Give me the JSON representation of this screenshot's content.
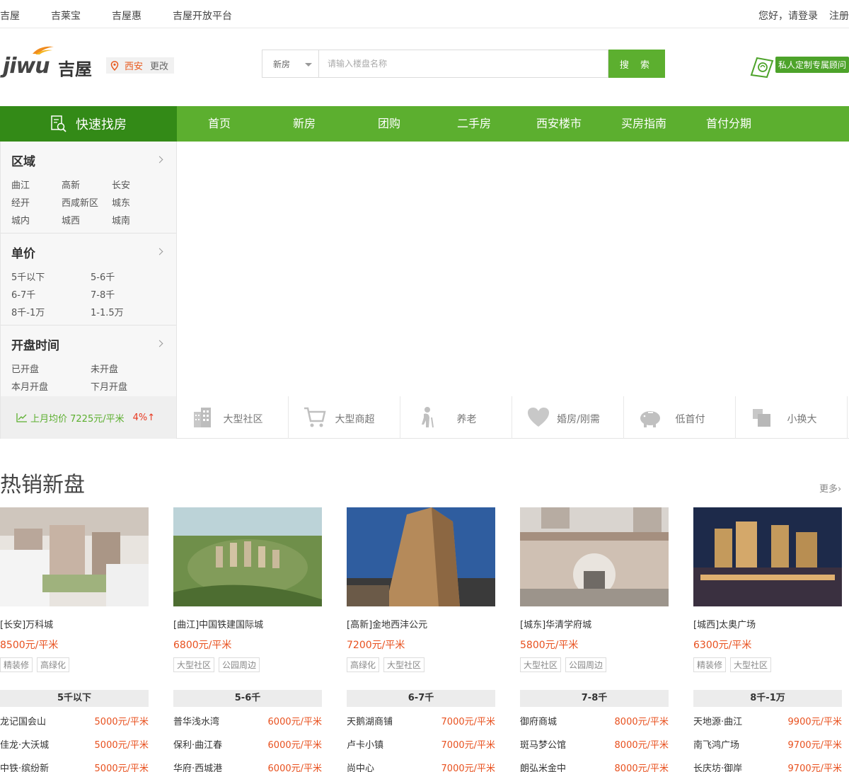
{
  "topbar": {
    "links": [
      "吉屋",
      "吉莱宝",
      "吉屋惠",
      "吉屋开放平台"
    ],
    "greeting": "您好，请登录",
    "register": "注册"
  },
  "header": {
    "logo_text": "jiwu",
    "logo_cn": "吉屋",
    "city": "西安",
    "change_city": "更改",
    "search_type": "新房",
    "search_placeholder": "请输入楼盘名称",
    "search_button": "搜 索",
    "advisor_label": "私人定制专属顾问"
  },
  "nav": {
    "quick": "快速找房",
    "items": [
      "首页",
      "新房",
      "团购",
      "二手房",
      "西安楼市",
      "买房指南",
      "首付分期"
    ]
  },
  "sidebar": {
    "region": {
      "title": "区域",
      "options": [
        "曲江",
        "高新",
        "长安",
        "经开",
        "西咸新区",
        "城东",
        "城内",
        "城西",
        "城南"
      ]
    },
    "price": {
      "title": "单价",
      "options": [
        "5千以下",
        "5-6千",
        "6-7千",
        "7-8千",
        "8千-1万",
        "1-1.5万"
      ]
    },
    "opening": {
      "title": "开盘时间",
      "options": [
        "已开盘",
        "未开盘",
        "本月开盘",
        "下月开盘"
      ]
    },
    "avg_price": "上月均价 7225元/平米",
    "avg_change": "4%↑"
  },
  "features": [
    {
      "label": "大型社区",
      "icon": "building-icon"
    },
    {
      "label": "大型商超",
      "icon": "cart-icon"
    },
    {
      "label": "养老",
      "icon": "elder-icon"
    },
    {
      "label": "婚房/刚需",
      "icon": "heart-icon"
    },
    {
      "label": "低首付",
      "icon": "piggy-bank-icon"
    },
    {
      "label": "小换大",
      "icon": "squares-icon"
    }
  ],
  "hot": {
    "title": "热销新盘",
    "more": "更多",
    "cards": [
      {
        "name": "[长安]万科城",
        "price": "8500元/平米",
        "tags": [
          "精装修",
          "高绿化"
        ]
      },
      {
        "name": "[曲江]中国铁建国际城",
        "price": "6800元/平米",
        "tags": [
          "大型社区",
          "公园周边"
        ]
      },
      {
        "name": "[高新]金地西沣公元",
        "price": "7200元/平米",
        "tags": [
          "高绿化",
          "大型社区"
        ]
      },
      {
        "name": "[城东]华清学府城",
        "price": "5800元/平米",
        "tags": [
          "大型社区",
          "公园周边"
        ]
      },
      {
        "name": "[城西]太奥广场",
        "price": "6300元/平米",
        "tags": [
          "精装修",
          "大型社区"
        ]
      }
    ]
  },
  "price_columns": [
    {
      "title": "5千以下",
      "rows": [
        {
          "name": "龙记国会山",
          "price": "5000元/平米"
        },
        {
          "name": "佳龙·大沃城",
          "price": "5000元/平米"
        },
        {
          "name": "中铁·缤纷新",
          "price": "5000元/平米"
        }
      ]
    },
    {
      "title": "5-6千",
      "rows": [
        {
          "name": "普华浅水湾",
          "price": "6000元/平米"
        },
        {
          "name": "保利·曲江春",
          "price": "6000元/平米"
        },
        {
          "name": "华府·西城港",
          "price": "6000元/平米"
        }
      ]
    },
    {
      "title": "6-7千",
      "rows": [
        {
          "name": "天鹅湖商铺",
          "price": "7000元/平米"
        },
        {
          "name": "卢卡小镇",
          "price": "7000元/平米"
        },
        {
          "name": "尚中心",
          "price": "7000元/平米"
        }
      ]
    },
    {
      "title": "7-8千",
      "rows": [
        {
          "name": "御府商城",
          "price": "8000元/平米"
        },
        {
          "name": "斑马梦公馆",
          "price": "8000元/平米"
        },
        {
          "name": "朗弘米金中",
          "price": "8000元/平米"
        }
      ]
    },
    {
      "title": "8千-1万",
      "rows": [
        {
          "name": "天地源·曲江",
          "price": "9900元/平米"
        },
        {
          "name": "南飞鸿广场",
          "price": "9700元/平米"
        },
        {
          "name": "长庆坊·御岸",
          "price": "9700元/平米"
        }
      ]
    }
  ],
  "colors": {
    "brand_green": "#5caf2f",
    "dark_green": "#338a17",
    "price_red": "#e8501e"
  }
}
